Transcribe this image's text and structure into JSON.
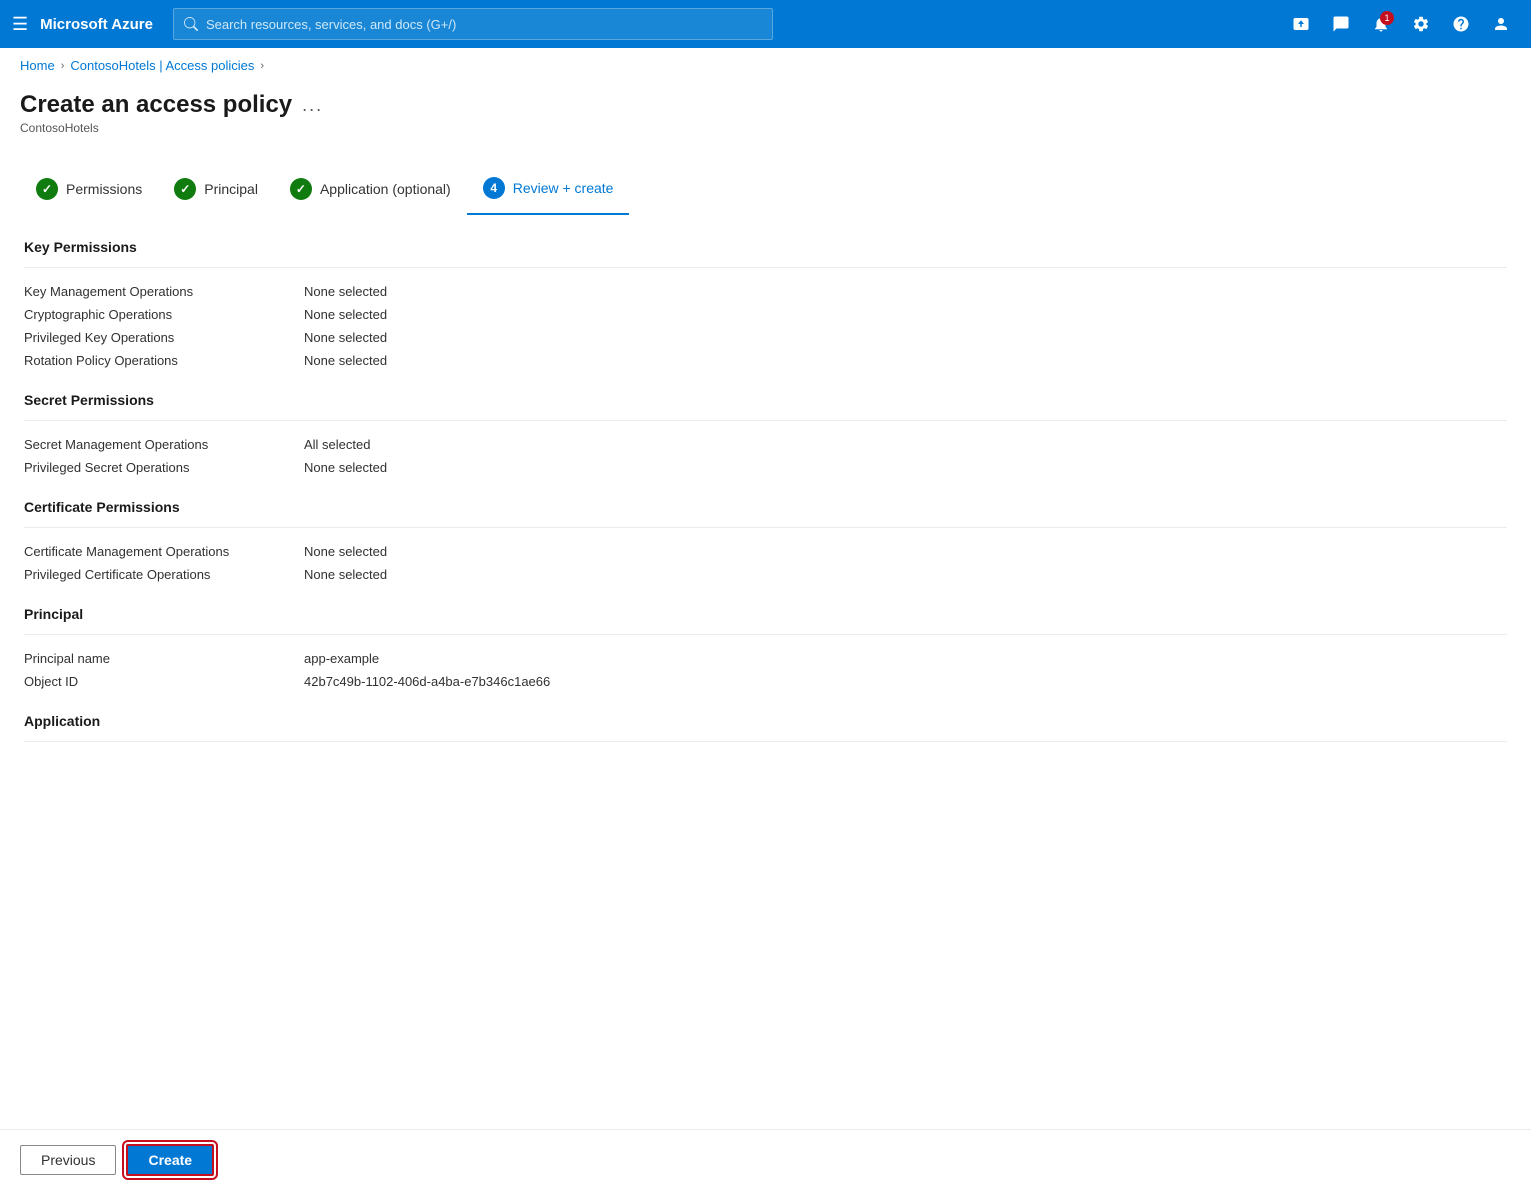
{
  "topnav": {
    "brand": "Microsoft Azure",
    "search_placeholder": "Search resources, services, and docs (G+/)",
    "notification_count": "1"
  },
  "breadcrumb": {
    "items": [
      "Home",
      "ContosoHotels | Access policies"
    ]
  },
  "page": {
    "title": "Create an access policy",
    "subtitle": "ContosoHotels",
    "menu_dots": "..."
  },
  "wizard": {
    "steps": [
      {
        "label": "Permissions",
        "state": "completed",
        "number": "1"
      },
      {
        "label": "Principal",
        "state": "completed",
        "number": "2"
      },
      {
        "label": "Application (optional)",
        "state": "completed",
        "number": "3"
      },
      {
        "label": "Review + create",
        "state": "active",
        "number": "4"
      }
    ]
  },
  "sections": {
    "key_permissions": {
      "title": "Key Permissions",
      "rows": [
        {
          "label": "Key Management Operations",
          "value": "None selected"
        },
        {
          "label": "Cryptographic Operations",
          "value": "None selected"
        },
        {
          "label": "Privileged Key Operations",
          "value": "None selected"
        },
        {
          "label": "Rotation Policy Operations",
          "value": "None selected"
        }
      ]
    },
    "secret_permissions": {
      "title": "Secret Permissions",
      "rows": [
        {
          "label": "Secret Management Operations",
          "value": "All selected"
        },
        {
          "label": "Privileged Secret Operations",
          "value": "None selected"
        }
      ]
    },
    "certificate_permissions": {
      "title": "Certificate Permissions",
      "rows": [
        {
          "label": "Certificate Management Operations",
          "value": "None selected"
        },
        {
          "label": "Privileged Certificate Operations",
          "value": "None selected"
        }
      ]
    },
    "principal": {
      "title": "Principal",
      "rows": [
        {
          "label": "Principal name",
          "value": "app-example"
        },
        {
          "label": "Object ID",
          "value": "42b7c49b-1102-406d-a4ba-e7b346c1ae66"
        }
      ]
    },
    "application": {
      "title": "Application"
    }
  },
  "footer": {
    "previous_label": "Previous",
    "create_label": "Create"
  }
}
